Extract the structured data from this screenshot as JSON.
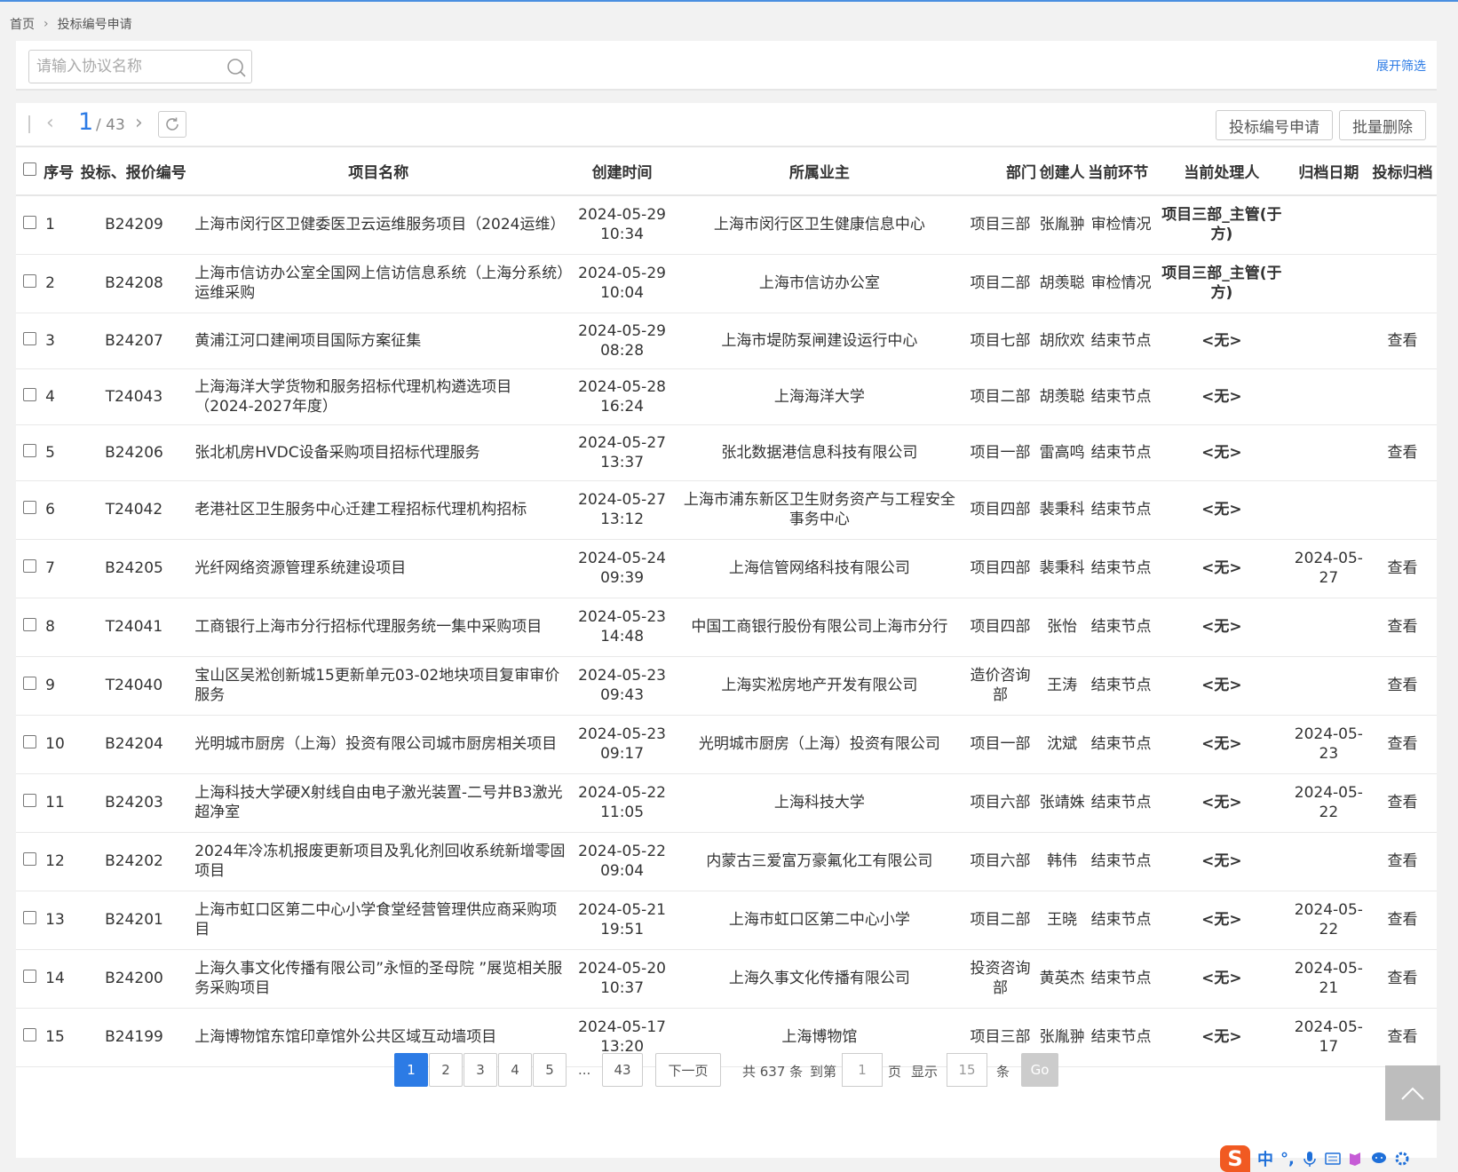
{
  "breadcrumb": {
    "home": "首页",
    "current": "投标编号申请"
  },
  "search": {
    "placeholder": "请输入协议名称",
    "expand_filter": "展开筛选"
  },
  "toolbar": {
    "current_page": "1",
    "total_pages": "/ 43",
    "apply_button": "投标编号申请",
    "batch_delete_button": "批量删除"
  },
  "table": {
    "headers": [
      "序号",
      "投标、报价编号",
      "项目名称",
      "创建时间",
      "所属业主",
      "部门",
      "创建人",
      "当前环节",
      "当前处理人",
      "归档日期",
      "投标归档"
    ],
    "rows": [
      {
        "no": "1",
        "code": "B24209",
        "name": "上海市闵行区卫健委医卫云运维服务项目（2024运维）",
        "created": "2024-05-29 10:34",
        "owner": "上海市闵行区卫生健康信息中心",
        "dept": "项目三部",
        "creator": "张胤翀",
        "stage": "审检情况",
        "handler": "项目三部_主管(于方)",
        "archive_date": "",
        "archive": ""
      },
      {
        "no": "2",
        "code": "B24208",
        "name": "上海市信访办公室全国网上信访信息系统（上海分系统）运维采购",
        "created": "2024-05-29 10:04",
        "owner": "上海市信访办公室",
        "dept": "项目二部",
        "creator": "胡羡聪",
        "stage": "审检情况",
        "handler": "项目三部_主管(于方)",
        "archive_date": "",
        "archive": ""
      },
      {
        "no": "3",
        "code": "B24207",
        "name": "黄浦江河口建闸项目国际方案征集",
        "created": "2024-05-29 08:28",
        "owner": "上海市堤防泵闸建设运行中心",
        "dept": "项目七部",
        "creator": "胡欣欢",
        "stage": "结束节点",
        "handler": "<无>",
        "archive_date": "",
        "archive": "查看"
      },
      {
        "no": "4",
        "code": "T24043",
        "name": "上海海洋大学货物和服务招标代理机构遴选项目（2024-2027年度）",
        "created": "2024-05-28 16:24",
        "owner": "上海海洋大学",
        "dept": "项目二部",
        "creator": "胡羡聪",
        "stage": "结束节点",
        "handler": "<无>",
        "archive_date": "",
        "archive": ""
      },
      {
        "no": "5",
        "code": "B24206",
        "name": "张北机房HVDC设备采购项目招标代理服务",
        "created": "2024-05-27 13:37",
        "owner": "张北数据港信息科技有限公司",
        "dept": "项目一部",
        "creator": "雷高鸣",
        "stage": "结束节点",
        "handler": "<无>",
        "archive_date": "",
        "archive": "查看"
      },
      {
        "no": "6",
        "code": "T24042",
        "name": "老港社区卫生服务中心迁建工程招标代理机构招标",
        "created": "2024-05-27 13:12",
        "owner": "上海市浦东新区卫生财务资产与工程安全事务中心",
        "dept": "项目四部",
        "creator": "裴秉科",
        "stage": "结束节点",
        "handler": "<无>",
        "archive_date": "",
        "archive": ""
      },
      {
        "no": "7",
        "code": "B24205",
        "name": "光纤网络资源管理系统建设项目",
        "created": "2024-05-24 09:39",
        "owner": "上海信管网络科技有限公司",
        "dept": "项目四部",
        "creator": "裴秉科",
        "stage": "结束节点",
        "handler": "<无>",
        "archive_date": "2024-05-27",
        "archive": "查看"
      },
      {
        "no": "8",
        "code": "T24041",
        "name": "工商银行上海市分行招标代理服务统一集中采购项目",
        "created": "2024-05-23 14:48",
        "owner": "中国工商银行股份有限公司上海市分行",
        "dept": "项目四部",
        "creator": "张怡",
        "stage": "结束节点",
        "handler": "<无>",
        "archive_date": "",
        "archive": "查看"
      },
      {
        "no": "9",
        "code": "T24040",
        "name": "宝山区吴淞创新城15更新单元03-02地块项目复审审价服务",
        "created": "2024-05-23 09:43",
        "owner": "上海实淞房地产开发有限公司",
        "dept": "造价咨询部",
        "creator": "王涛",
        "stage": "结束节点",
        "handler": "<无>",
        "archive_date": "",
        "archive": "查看"
      },
      {
        "no": "10",
        "code": "B24204",
        "name": "光明城市厨房（上海）投资有限公司城市厨房相关项目",
        "created": "2024-05-23 09:17",
        "owner": "光明城市厨房（上海）投资有限公司",
        "dept": "项目一部",
        "creator": "沈斌",
        "stage": "结束节点",
        "handler": "<无>",
        "archive_date": "2024-05-23",
        "archive": "查看"
      },
      {
        "no": "11",
        "code": "B24203",
        "name": "上海科技大学硬X射线自由电子激光装置-二号井B3激光超净室",
        "created": "2024-05-22 11:05",
        "owner": "上海科技大学",
        "dept": "项目六部",
        "creator": "张靖姝",
        "stage": "结束节点",
        "handler": "<无>",
        "archive_date": "2024-05-22",
        "archive": "查看"
      },
      {
        "no": "12",
        "code": "B24202",
        "name": "2024年冷冻机报废更新项目及乳化剂回收系统新增零固项目",
        "created": "2024-05-22 09:04",
        "owner": "内蒙古三爱富万豪氟化工有限公司",
        "dept": "项目六部",
        "creator": "韩伟",
        "stage": "结束节点",
        "handler": "<无>",
        "archive_date": "",
        "archive": "查看"
      },
      {
        "no": "13",
        "code": "B24201",
        "name": "上海市虹口区第二中心小学食堂经营管理供应商采购项目",
        "created": "2024-05-21 19:51",
        "owner": "上海市虹口区第二中心小学",
        "dept": "项目二部",
        "creator": "王晓",
        "stage": "结束节点",
        "handler": "<无>",
        "archive_date": "2024-05-22",
        "archive": "查看"
      },
      {
        "no": "14",
        "code": "B24200",
        "name": "上海久事文化传播有限公司”永恒的圣母院 ”展览相关服务采购项目",
        "created": "2024-05-20 10:37",
        "owner": "上海久事文化传播有限公司",
        "dept": "投资咨询部",
        "creator": "黄英杰",
        "stage": "结束节点",
        "handler": "<无>",
        "archive_date": "2024-05-21",
        "archive": "查看"
      },
      {
        "no": "15",
        "code": "B24199",
        "name": "上海博物馆东馆印章馆外公共区域互动墙项目",
        "created": "2024-05-17 13:20",
        "owner": "上海博物馆",
        "dept": "项目三部",
        "creator": "张胤翀",
        "stage": "结束节点",
        "handler": "<无>",
        "archive_date": "2024-05-17",
        "archive": "查看"
      }
    ]
  },
  "pager": {
    "pages": [
      "1",
      "2",
      "3",
      "4",
      "5"
    ],
    "ellipsis": "...",
    "last": "43",
    "next": "下一页",
    "total": "共 637 条",
    "goto_label": "到第",
    "goto_value": "1",
    "page_unit": "页",
    "show_label": "显示",
    "show_value": "15",
    "item_unit": "条",
    "go": "Go"
  },
  "ime": {
    "label": "中",
    "punct": "°,"
  },
  "colors": {
    "accent": "#2c7be5",
    "brand_ime": "#f15a22"
  }
}
